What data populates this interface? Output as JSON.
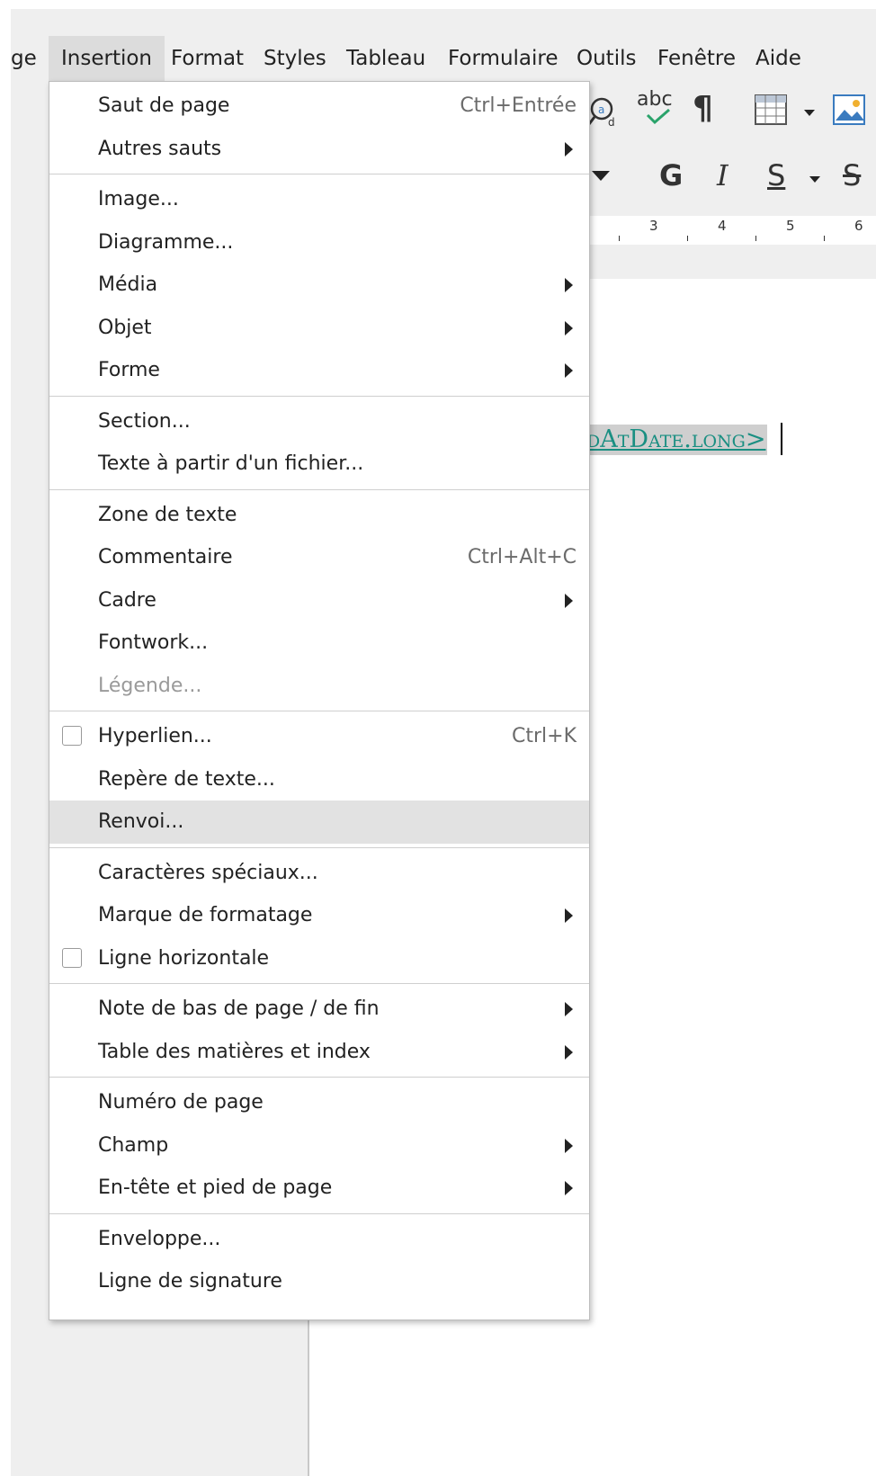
{
  "menubar": {
    "items": [
      "ge",
      "Insertion",
      "Format",
      "Styles",
      "Tableau",
      "Formulaire",
      "Outils",
      "Fenêtre",
      "Aide"
    ],
    "active": "Insertion"
  },
  "toolbar": {
    "bold_label": "G",
    "italic_label": "I",
    "underline_label": "S",
    "strike_label": "S",
    "spellcheck_label": "abc",
    "formatting_marks_glyph": "¶"
  },
  "ruler": {
    "ticks": [
      "3",
      "4",
      "5",
      "6"
    ]
  },
  "document": {
    "field_text": "dAtDate.long>"
  },
  "insert_menu": {
    "groups": [
      [
        {
          "label": "Saut de page",
          "shortcut": "Ctrl+Entrée"
        },
        {
          "label": "Autres sauts",
          "submenu": true
        }
      ],
      [
        {
          "label": "Image..."
        },
        {
          "label": "Diagramme..."
        },
        {
          "label": "Média",
          "submenu": true
        },
        {
          "label": "Objet",
          "submenu": true
        },
        {
          "label": "Forme",
          "submenu": true
        }
      ],
      [
        {
          "label": "Section..."
        },
        {
          "label": "Texte à partir d'un fichier..."
        }
      ],
      [
        {
          "label": "Zone de texte"
        },
        {
          "label": "Commentaire",
          "shortcut": "Ctrl+Alt+C"
        },
        {
          "label": "Cadre",
          "submenu": true
        },
        {
          "label": "Fontwork..."
        },
        {
          "label": "Légende...",
          "disabled": true
        }
      ],
      [
        {
          "label": "Hyperlien...",
          "shortcut": "Ctrl+K",
          "checkbox": true
        },
        {
          "label": "Repère de texte..."
        },
        {
          "label": "Renvoi...",
          "highlighted": true
        }
      ],
      [
        {
          "label": "Caractères spéciaux..."
        },
        {
          "label": "Marque de formatage",
          "submenu": true
        },
        {
          "label": "Ligne horizontale",
          "checkbox": true
        }
      ],
      [
        {
          "label": "Note de bas de page / de fin",
          "submenu": true
        },
        {
          "label": "Table des matières et index",
          "submenu": true
        }
      ],
      [
        {
          "label": "Numéro de page"
        },
        {
          "label": "Champ",
          "submenu": true
        },
        {
          "label": "En-tête et pied de page",
          "submenu": true
        }
      ],
      [
        {
          "label": "Enveloppe..."
        },
        {
          "label": "Ligne de signature"
        }
      ]
    ]
  }
}
